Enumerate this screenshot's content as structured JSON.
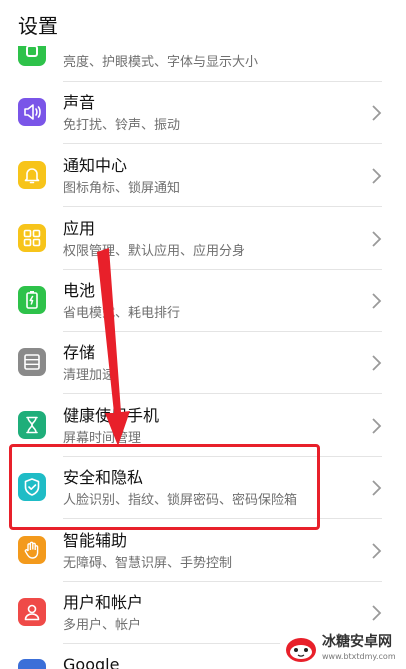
{
  "header": {
    "title": "设置"
  },
  "rows": [
    {
      "title": "",
      "subtitle": "亮度、护眼模式、字体与显示大小",
      "icon": "display-icon",
      "color": "#2ec24a"
    },
    {
      "title": "声音",
      "subtitle": "免打扰、铃声、振动",
      "icon": "speaker-icon",
      "color": "#7a55e8"
    },
    {
      "title": "通知中心",
      "subtitle": "图标角标、锁屏通知",
      "icon": "bell-icon",
      "color": "#f7c41a"
    },
    {
      "title": "应用",
      "subtitle": "权限管理、默认应用、应用分身",
      "icon": "apps-grid-icon",
      "color": "#f7c41a"
    },
    {
      "title": "电池",
      "subtitle": "省电模式、耗电排行",
      "icon": "battery-icon",
      "color": "#2ec24a"
    },
    {
      "title": "存储",
      "subtitle": "清理加速",
      "icon": "storage-icon",
      "color": "#8a8a8a"
    },
    {
      "title": "健康使用手机",
      "subtitle": "屏幕时间管理",
      "icon": "hourglass-icon",
      "color": "#1fae7a"
    },
    {
      "title": "安全和隐私",
      "subtitle": "人脸识别、指纹、锁屏密码、密码保险箱",
      "icon": "shield-icon",
      "color": "#1fbcc6"
    },
    {
      "title": "智能辅助",
      "subtitle": "无障碍、智慧识屏、手势控制",
      "icon": "hand-icon",
      "color": "#f39a1c"
    },
    {
      "title": "用户和帐户",
      "subtitle": "多用户、帐户",
      "icon": "user-icon",
      "color": "#ef4a48"
    },
    {
      "title": "Google",
      "subtitle": "",
      "icon": "google-icon",
      "color": "#3b6fd8"
    }
  ],
  "watermark": {
    "name": "冰糖安卓网",
    "url": "www.btxtdmy.com"
  }
}
